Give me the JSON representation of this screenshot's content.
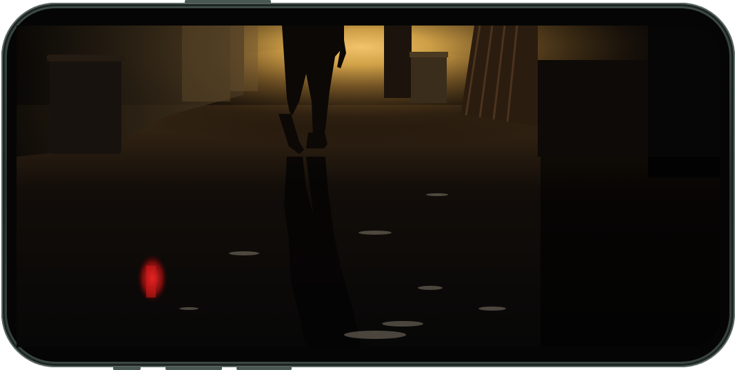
{
  "device": {
    "model_shape": "smartphone-landscape",
    "frame_color": "#2f3a36",
    "screen_content": "video-frame"
  },
  "colors": {
    "light_glow": "#d7a64a",
    "shadow": "#050505",
    "red_reflection": "#d31a1a"
  }
}
